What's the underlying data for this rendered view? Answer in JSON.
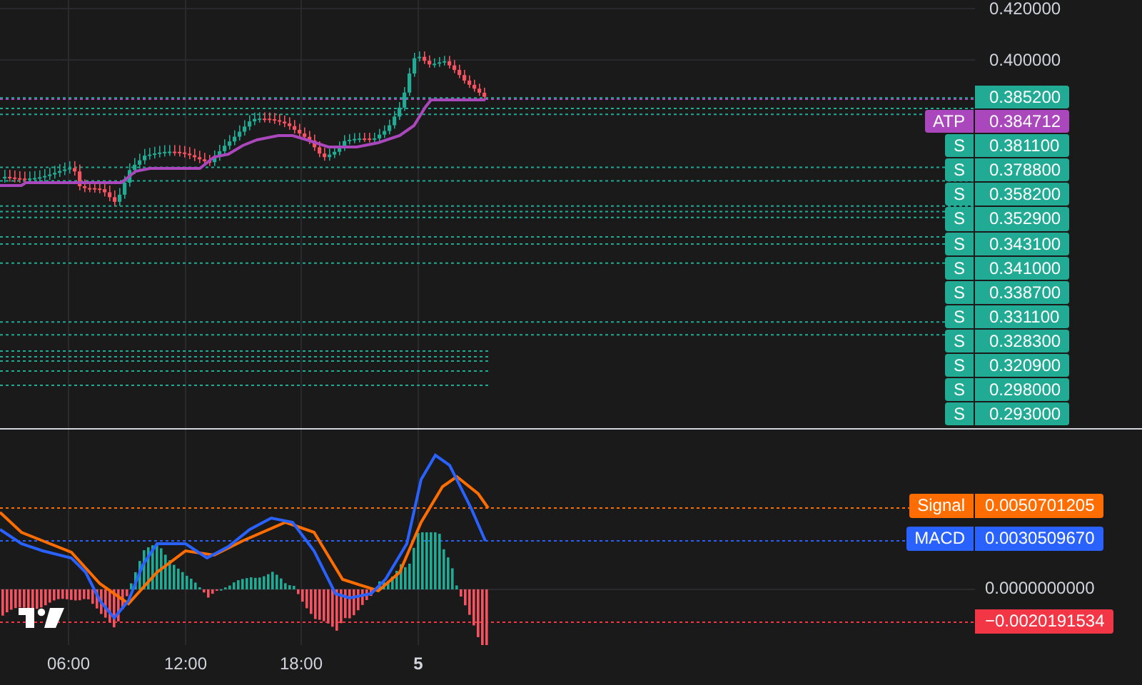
{
  "price_axis": {
    "ticks": [
      "0.420000",
      "0.400000"
    ],
    "labels": [
      {
        "value": "0.385200",
        "color": "#22ab94"
      },
      {
        "tag": "ATP",
        "value": "0.384712",
        "color": "#ab47bc"
      },
      {
        "tag": "S",
        "value": "0.381100",
        "color": "#22ab94"
      },
      {
        "tag": "S",
        "value": "0.378800",
        "color": "#22ab94"
      },
      {
        "tag": "S",
        "value": "0.358200",
        "color": "#22ab94"
      },
      {
        "tag": "S",
        "value": "0.352900",
        "color": "#22ab94"
      },
      {
        "tag": "S",
        "value": "0.343100",
        "color": "#22ab94"
      },
      {
        "tag": "S",
        "value": "0.341000",
        "color": "#22ab94"
      },
      {
        "tag": "S",
        "value": "0.338700",
        "color": "#22ab94"
      },
      {
        "tag": "S",
        "value": "0.331100",
        "color": "#22ab94"
      },
      {
        "tag": "S",
        "value": "0.328300",
        "color": "#22ab94"
      },
      {
        "tag": "S",
        "value": "0.320900",
        "color": "#22ab94"
      },
      {
        "tag": "S",
        "value": "0.298000",
        "color": "#22ab94"
      },
      {
        "tag": "S",
        "value": "0.293000",
        "color": "#22ab94"
      }
    ]
  },
  "macd_axis": {
    "labels": [
      {
        "tag": "Signal",
        "value": "0.0050701205",
        "color": "#ff6d00"
      },
      {
        "tag": "MACD",
        "value": "0.0030509670",
        "color": "#2962ff"
      },
      {
        "value": "0.0000000000"
      },
      {
        "value": "−0.0020191534",
        "color": "#f23645"
      }
    ]
  },
  "time_axis": [
    {
      "label": "06:00",
      "kind": "time"
    },
    {
      "label": "12:00",
      "kind": "time"
    },
    {
      "label": "18:00",
      "kind": "time"
    },
    {
      "label": "5",
      "kind": "day"
    }
  ]
}
